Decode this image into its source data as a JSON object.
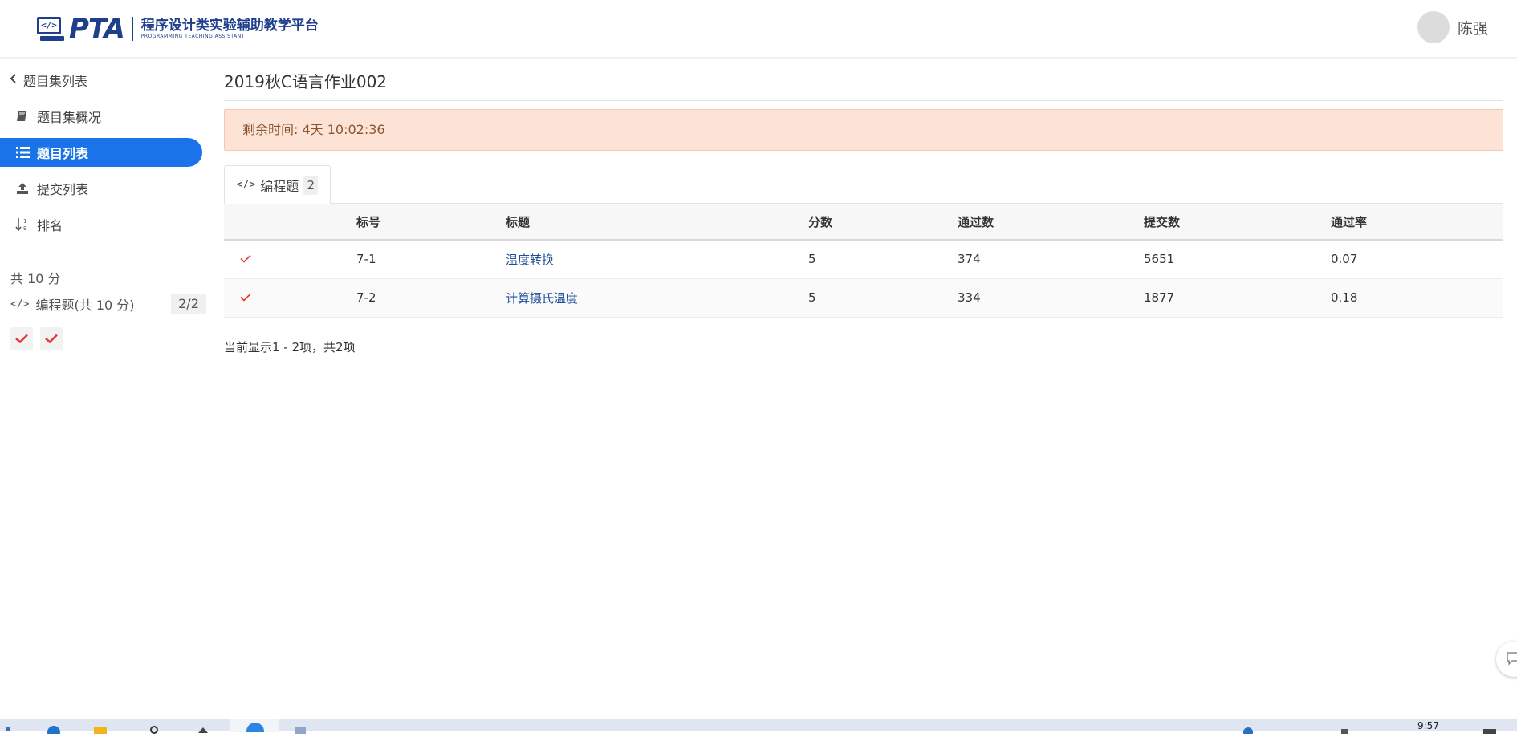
{
  "header": {
    "logo_code": "</>",
    "logo_name": "PTA",
    "logo_title": "程序设计类实验辅助教学平台",
    "logo_subtitle": "PROGRAMMING TEACHING ASSISTANT",
    "user_name": "陈强"
  },
  "sidebar": {
    "back_label": "题目集列表",
    "items": [
      {
        "label": "题目集概况",
        "icon": "book-icon"
      },
      {
        "label": "题目列表",
        "icon": "list-icon",
        "active": true
      },
      {
        "label": "提交列表",
        "icon": "upload-icon"
      },
      {
        "label": "排名",
        "icon": "sort-numeric-icon"
      }
    ],
    "total_score": "共 10 分",
    "category": {
      "label": "编程题(共 10 分)",
      "progress": "2/2"
    },
    "status_count": 2
  },
  "main": {
    "title": "2019秋C语言作业002",
    "alert": "剩余时间: 4天 10:02:36",
    "tab": {
      "label": "编程题",
      "count": "2"
    },
    "table": {
      "headers": [
        "",
        "标号",
        "标题",
        "分数",
        "通过数",
        "提交数",
        "通过率"
      ],
      "rows": [
        {
          "status": "accepted",
          "id": "7-1",
          "title": "温度转换",
          "score": "5",
          "passed": "374",
          "submitted": "5651",
          "rate": "0.07"
        },
        {
          "status": "accepted",
          "id": "7-2",
          "title": "计算摄氏温度",
          "score": "5",
          "passed": "334",
          "submitted": "1877",
          "rate": "0.18"
        }
      ]
    },
    "pager_info": "当前显示1 - 2项，共2项"
  },
  "taskbar": {
    "clock": "9:57"
  },
  "colors": {
    "brand": "#1f3f8c",
    "active_nav": "#1a73e8",
    "accepted": "#e53935",
    "alert_bg": "#fde3d6",
    "link": "#1f4d9a"
  }
}
